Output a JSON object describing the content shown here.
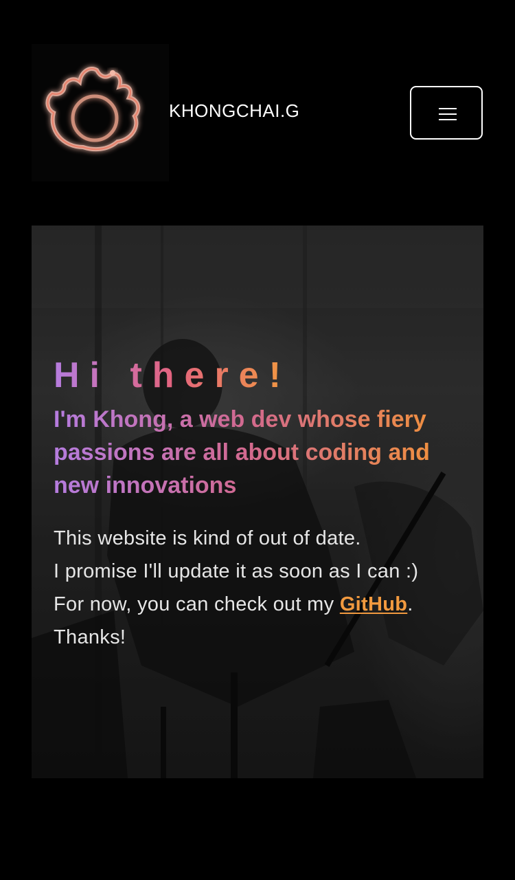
{
  "header": {
    "brand": "KHONGCHAI.G",
    "logo_icon": "flame-logo-icon",
    "menu_icon": "hamburger-menu-icon"
  },
  "hero": {
    "greeting": "Hi there!",
    "tagline": "I'm Khong, a web dev whose fiery passions are all about coding and new innovations",
    "note_line1": "This website is kind of out of date.",
    "note_line2": "I promise I'll update it as soon as I can :)",
    "note_line3_prefix": "For now, you can check out my ",
    "github_link": "GitHub",
    "note_line3_suffix": ".",
    "note_line4": "Thanks!"
  },
  "colors": {
    "gradient_start": "#b57cdf",
    "gradient_mid": "#e3647f",
    "gradient_end": "#f29a3f",
    "link": "#f29a3f",
    "background": "#000000"
  }
}
